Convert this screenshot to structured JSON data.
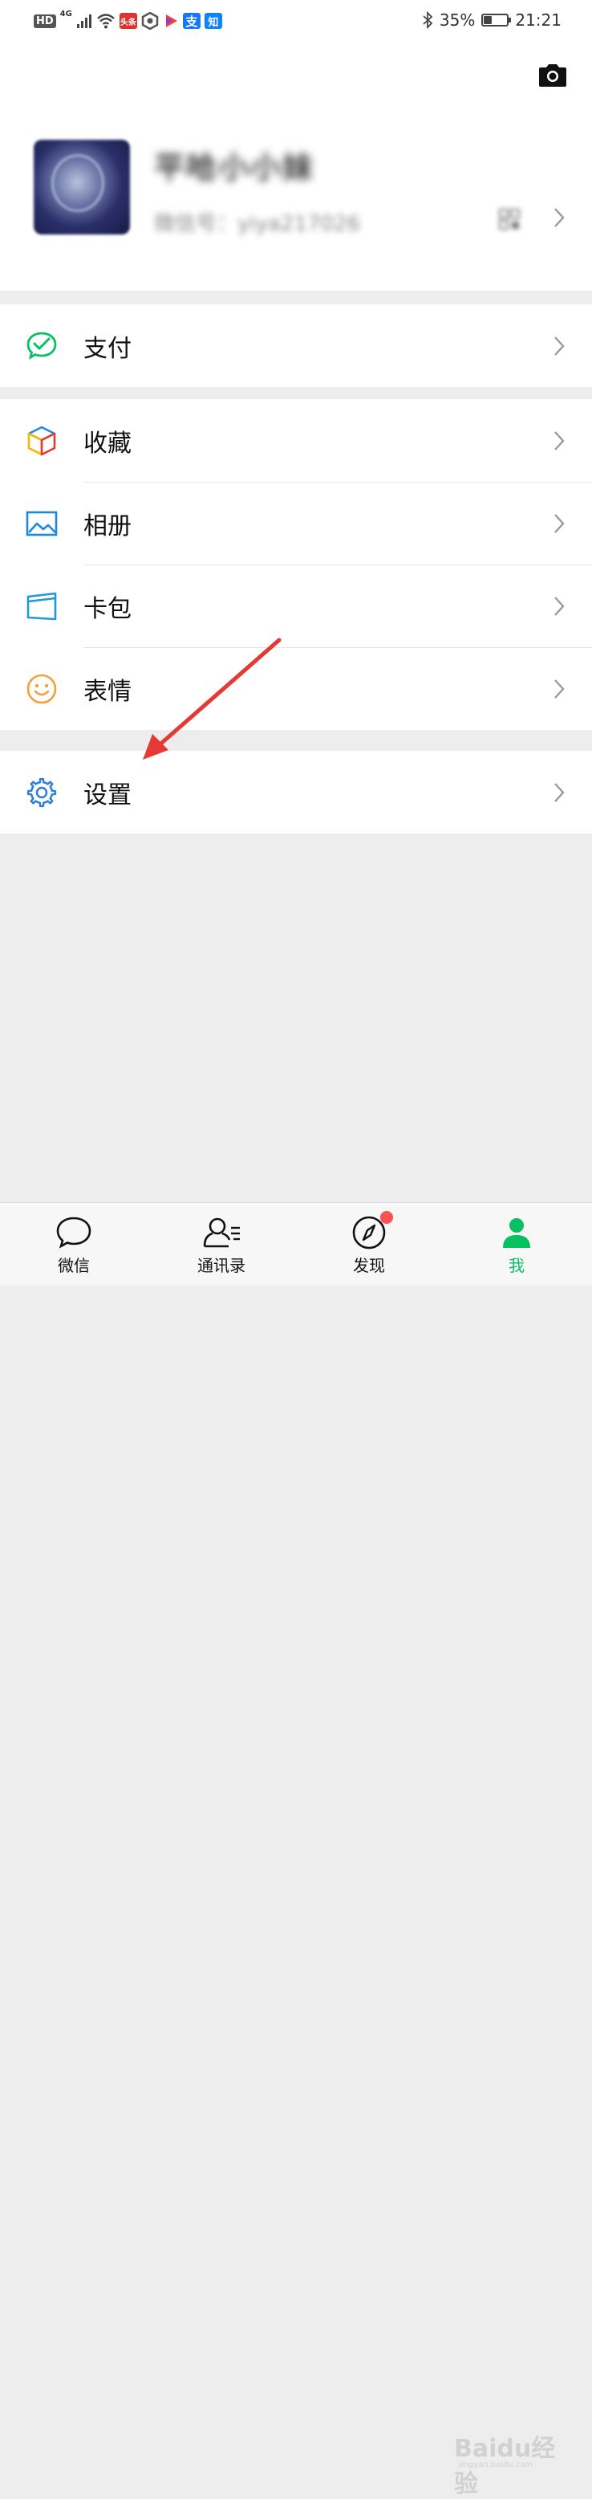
{
  "status_bar": {
    "network_hd": "HD",
    "network_type": "4G",
    "battery_percent": "35%",
    "battery_level": 0.35,
    "time": "21:21",
    "notification_icons": [
      "toutiao-icon",
      "pixel-app-icon",
      "video-player-icon",
      "alipay-icon",
      "zhihu-icon"
    ]
  },
  "profile": {
    "nickname": "平哈小小妹",
    "wechat_id": "微信号：yiya217026",
    "camera_icon": "camera-icon",
    "qr_icon": "qr-code-icon"
  },
  "menu": {
    "pay": {
      "label": "支付",
      "icon": "pay-icon",
      "color": "#07c160"
    },
    "favorites": {
      "label": "收藏",
      "icon": "favorites-cube-icon"
    },
    "album": {
      "label": "相册",
      "icon": "album-icon",
      "color": "#1e88e5"
    },
    "cards": {
      "label": "卡包",
      "icon": "card-wallet-icon",
      "color": "#1e9ad6"
    },
    "stickers": {
      "label": "表情",
      "icon": "sticker-smile-icon",
      "color": "#f2a138"
    },
    "settings": {
      "label": "设置",
      "icon": "gear-icon",
      "color": "#2f7fd6"
    }
  },
  "tab_bar": {
    "tabs": [
      {
        "label": "微信",
        "icon": "chat-bubble-icon"
      },
      {
        "label": "通讯录",
        "icon": "contacts-icon"
      },
      {
        "label": "发现",
        "icon": "compass-icon",
        "has_badge": true
      },
      {
        "label": "我",
        "icon": "me-person-icon",
        "active": true
      }
    ],
    "active_color": "#07c160",
    "badge_color": "#fa5151"
  },
  "watermark": {
    "text": "Baidu经验",
    "sub": "jingyan.baidu.com"
  },
  "annotation": {
    "color": "#e53935"
  }
}
